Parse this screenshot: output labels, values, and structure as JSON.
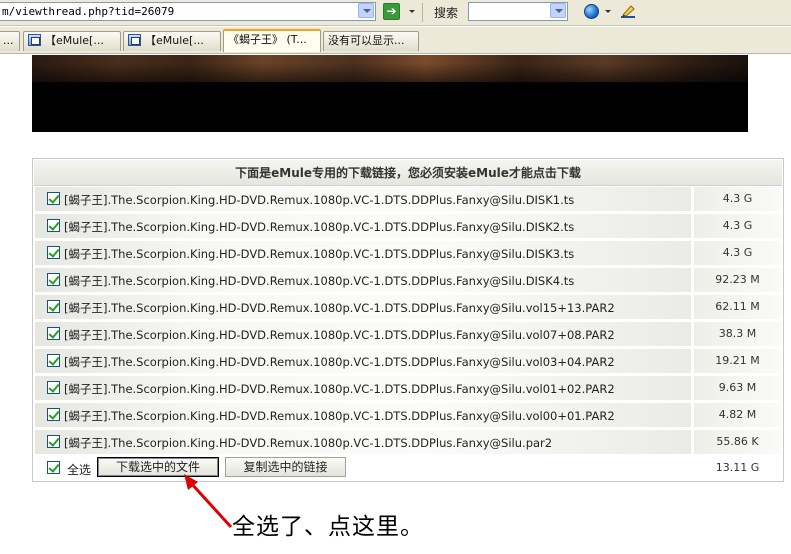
{
  "toolbar": {
    "address": "m/viewthread.php?tid=26079",
    "search_label": "搜索",
    "search_value": "",
    "go_icon": "go-arrow-icon",
    "accent": "#3a9a3a"
  },
  "tabs": [
    {
      "label": "..."
    },
    {
      "label": "【eMule[..."
    },
    {
      "label": "【eMule[..."
    },
    {
      "label": "《蝎子王》 (T..."
    },
    {
      "label": "没有可以显示..."
    }
  ],
  "download": {
    "header": "下面是eMule专用的下载链接，您必须安装eMule才能点击下载",
    "files": [
      {
        "name": "[蝎子王].The.Scorpion.King.HD-DVD.Remux.1080p.VC-1.DTS.DDPlus.Fanxy@Silu.DISK1.ts",
        "size": "4.3 G",
        "checked": true
      },
      {
        "name": "[蝎子王].The.Scorpion.King.HD-DVD.Remux.1080p.VC-1.DTS.DDPlus.Fanxy@Silu.DISK2.ts",
        "size": "4.3 G",
        "checked": true
      },
      {
        "name": "[蝎子王].The.Scorpion.King.HD-DVD.Remux.1080p.VC-1.DTS.DDPlus.Fanxy@Silu.DISK3.ts",
        "size": "4.3 G",
        "checked": true
      },
      {
        "name": "[蝎子王].The.Scorpion.King.HD-DVD.Remux.1080p.VC-1.DTS.DDPlus.Fanxy@Silu.DISK4.ts",
        "size": "92.23 M",
        "checked": true
      },
      {
        "name": "[蝎子王].The.Scorpion.King.HD-DVD.Remux.1080p.VC-1.DTS.DDPlus.Fanxy@Silu.vol15+13.PAR2",
        "size": "62.11 M",
        "checked": true
      },
      {
        "name": "[蝎子王].The.Scorpion.King.HD-DVD.Remux.1080p.VC-1.DTS.DDPlus.Fanxy@Silu.vol07+08.PAR2",
        "size": "38.3 M",
        "checked": true
      },
      {
        "name": "[蝎子王].The.Scorpion.King.HD-DVD.Remux.1080p.VC-1.DTS.DDPlus.Fanxy@Silu.vol03+04.PAR2",
        "size": "19.21 M",
        "checked": true
      },
      {
        "name": "[蝎子王].The.Scorpion.King.HD-DVD.Remux.1080p.VC-1.DTS.DDPlus.Fanxy@Silu.vol01+02.PAR2",
        "size": "9.63 M",
        "checked": true
      },
      {
        "name": "[蝎子王].The.Scorpion.King.HD-DVD.Remux.1080p.VC-1.DTS.DDPlus.Fanxy@Silu.vol00+01.PAR2",
        "size": "4.82 M",
        "checked": true
      },
      {
        "name": "[蝎子王].The.Scorpion.King.HD-DVD.Remux.1080p.VC-1.DTS.DDPlus.Fanxy@Silu.par2",
        "size": "55.86 K",
        "checked": true
      }
    ],
    "select_all_label": "全选",
    "select_all_checked": true,
    "download_button": "下载选中的文件",
    "copy_button": "复制选中的链接",
    "total_size": "13.11 G"
  },
  "annotation": {
    "text": "全选了、点这里。",
    "arrow_color": "#e00000"
  }
}
